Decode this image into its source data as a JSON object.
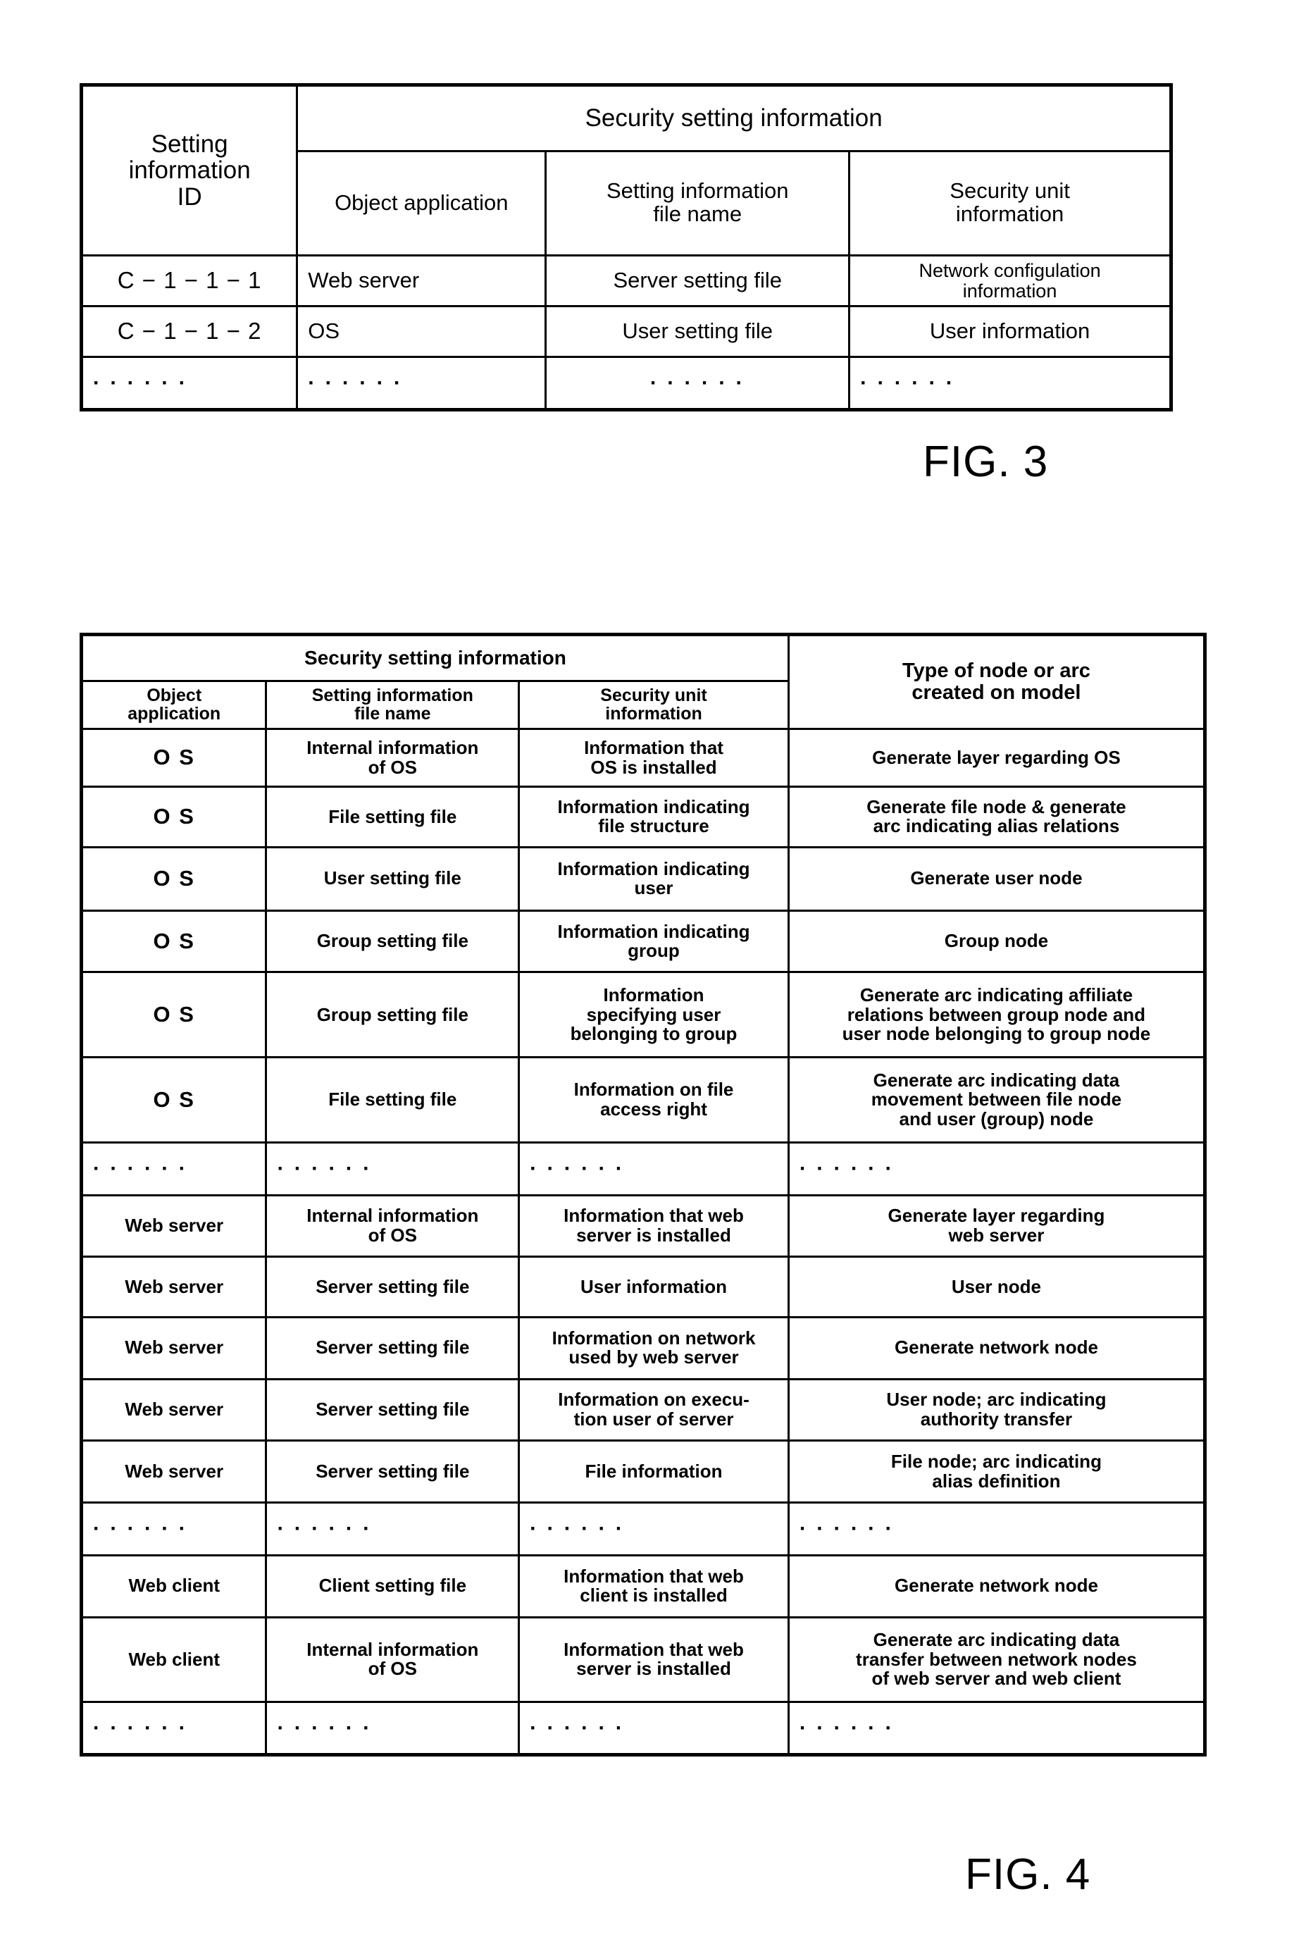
{
  "figures": [
    {
      "caption": "FIG. 3",
      "table": {
        "headers": {
          "id_col": "Setting\ninformation\nID",
          "group": "Security setting information",
          "sub": [
            "Object application",
            "Setting information\nfile name",
            "Security unit\ninformation"
          ]
        },
        "rows": [
          {
            "id": "C − 1 − 1 − 1",
            "object_application": "Web server",
            "file_name": "Server setting file",
            "security_unit": "Network configulation\ninformation"
          },
          {
            "id": "C − 1 − 1 − 2",
            "object_application": "OS",
            "file_name": "User setting file",
            "security_unit": "User information"
          },
          {
            "id": "· · · · · ·",
            "object_application": "· · · · · ·",
            "file_name": "· · · · · ·",
            "security_unit": "· · · · · ·"
          }
        ]
      }
    },
    {
      "caption": "FIG. 4",
      "table": {
        "headers": {
          "group": "Security setting information",
          "type_col": "Type of node or arc\ncreated on model",
          "sub": [
            "Object\napplication",
            "Setting information\nfile name",
            "Security unit\ninformation"
          ]
        },
        "rows": [
          {
            "object_application": "O S",
            "file_name": "Internal information\nof OS",
            "security_unit": "Information that\nOS is installed",
            "node_type": "Generate layer regarding OS"
          },
          {
            "object_application": "O S",
            "file_name": "File setting file",
            "security_unit": "Information indicating\nfile structure",
            "node_type": "Generate file node & generate\narc indicating alias relations"
          },
          {
            "object_application": "O S",
            "file_name": "User setting file",
            "security_unit": "Information indicating\nuser",
            "node_type": "Generate user node"
          },
          {
            "object_application": "O S",
            "file_name": "Group setting file",
            "security_unit": "Information indicating\ngroup",
            "node_type": "Group node"
          },
          {
            "object_application": "O S",
            "file_name": "Group setting file",
            "security_unit": "Information\nspecifying user\nbelonging to group",
            "node_type": "Generate arc indicating affiliate\nrelations between group node and\nuser node belonging to group node"
          },
          {
            "object_application": "O S",
            "file_name": "File setting file",
            "security_unit": "Information on file\naccess right",
            "node_type": "Generate arc indicating data\nmovement between file node\nand user (group) node"
          },
          {
            "object_application": "· · · · · ·",
            "file_name": "· · · · · ·",
            "security_unit": "· · · · · ·",
            "node_type": "· · · · · ·"
          },
          {
            "object_application": "Web server",
            "file_name": "Internal information\nof OS",
            "security_unit": "Information that web\nserver is installed",
            "node_type": "Generate layer regarding\nweb server"
          },
          {
            "object_application": "Web server",
            "file_name": "Server setting file",
            "security_unit": "User information",
            "node_type": "User node"
          },
          {
            "object_application": "Web server",
            "file_name": "Server setting file",
            "security_unit": "Information on network\nused by web server",
            "node_type": "Generate network node"
          },
          {
            "object_application": "Web server",
            "file_name": "Server setting file",
            "security_unit": "Information on execu-\ntion user of server",
            "node_type": "User node; arc indicating\nauthority transfer"
          },
          {
            "object_application": "Web server",
            "file_name": "Server setting file",
            "security_unit": "File information",
            "node_type": "File node; arc indicating\nalias definition"
          },
          {
            "object_application": "· · · · · ·",
            "file_name": "· · · · · ·",
            "security_unit": "· · · · · ·",
            "node_type": "· · · · · ·"
          },
          {
            "object_application": "Web client",
            "file_name": "Client setting file",
            "security_unit": "Information that web\nclient is installed",
            "node_type": "Generate network node"
          },
          {
            "object_application": "Web client",
            "file_name": "Internal information\nof OS",
            "security_unit": "Information that web\nserver is installed",
            "node_type": "Generate arc indicating data\ntransfer between network nodes\nof web server and web client"
          },
          {
            "object_application": "· · · · · ·",
            "file_name": "· · · · · ·",
            "security_unit": "· · · · · ·",
            "node_type": "· · · · · ·"
          }
        ]
      }
    }
  ]
}
